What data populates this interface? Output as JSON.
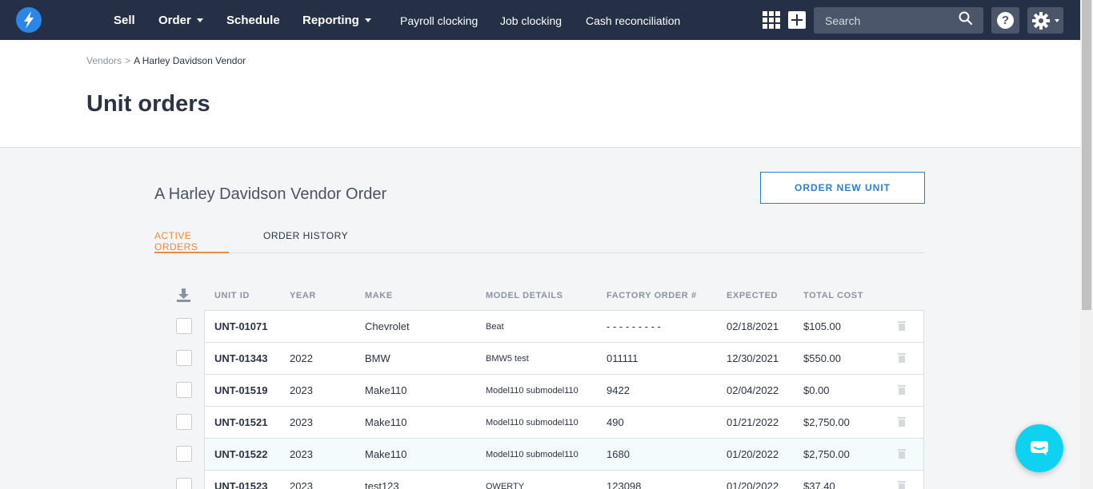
{
  "nav": {
    "items": [
      {
        "label": "Sell",
        "caret": false
      },
      {
        "label": "Order",
        "caret": true
      },
      {
        "label": "Schedule",
        "caret": false
      },
      {
        "label": "Reporting",
        "caret": true
      }
    ],
    "links": [
      "Payroll clocking",
      "Job clocking",
      "Cash reconciliation"
    ],
    "search_placeholder": "Search",
    "help_label": "?"
  },
  "header": {
    "breadcrumb_parent": "Vendors",
    "breadcrumb_sep": ">",
    "breadcrumb_current": "A Harley Davidson Vendor",
    "title": "Unit orders"
  },
  "content": {
    "section_title": "A Harley Davidson Vendor Order",
    "order_button_label": "ORDER NEW UNIT",
    "tabs": [
      "ACTIVE ORDERS",
      "ORDER HISTORY"
    ],
    "columns": [
      "UNIT ID",
      "YEAR",
      "MAKE",
      "MODEL DETAILS",
      "FACTORY ORDER #",
      "EXPECTED",
      "TOTAL COST"
    ],
    "rows": [
      {
        "id": "UNT-01071",
        "year": "",
        "make": "Chevrolet",
        "model": "Beat",
        "factory": "- - - - - - - - -",
        "expected": "02/18/2021",
        "cost": "$105.00"
      },
      {
        "id": "UNT-01343",
        "year": "2022",
        "make": "BMW",
        "model": "BMW5 test",
        "factory": "011111",
        "expected": "12/30/2021",
        "cost": "$550.00"
      },
      {
        "id": "UNT-01519",
        "year": "2023",
        "make": "Make110",
        "model": "Model110 submodel110",
        "factory": "9422",
        "expected": "02/04/2022",
        "cost": "$0.00"
      },
      {
        "id": "UNT-01521",
        "year": "2023",
        "make": "Make110",
        "model": "Model110 submodel110",
        "factory": "490",
        "expected": "01/21/2022",
        "cost": "$2,750.00"
      },
      {
        "id": "UNT-01522",
        "year": "2023",
        "make": "Make110",
        "model": "Model110 submodel110",
        "factory": "1680",
        "expected": "01/20/2022",
        "cost": "$2,750.00"
      },
      {
        "id": "UNT-01523",
        "year": "2023",
        "make": "test123",
        "model": "QWERTY",
        "factory": "123098",
        "expected": "01/20/2022",
        "cost": "$37.40"
      }
    ]
  },
  "colors": {
    "nav_bg": "#253046",
    "accent_orange": "#f08a3c",
    "accent_blue": "#2a7fd4",
    "chat_cyan": "#0fd1f0"
  }
}
